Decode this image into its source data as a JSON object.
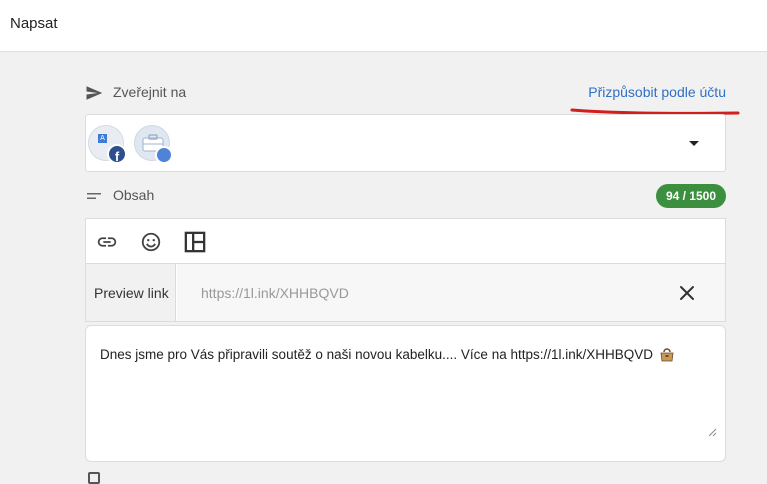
{
  "header": {
    "title": "Napsat"
  },
  "publish": {
    "label": "Zveřejnit na",
    "customize_link": "Přizpůsobit podle účtu"
  },
  "accounts": {
    "avatars": [
      {
        "type": "facebook",
        "icon": "facebook-icon",
        "badge": "f"
      },
      {
        "type": "google-my-business",
        "icon": "briefcase-icon"
      }
    ]
  },
  "content": {
    "label": "Obsah",
    "counter": "94 / 1500"
  },
  "toolbar": {
    "tools": [
      "link-icon",
      "emoji-icon",
      "layout-icon"
    ]
  },
  "preview": {
    "label": "Preview link",
    "placeholder": "https://1l.ink/XHHBQVD"
  },
  "post": {
    "text": "Dnes jsme pro Vás připravili soutěž o naši novou kabelku.... Více na https://1l.ink/XHHBQVD"
  },
  "colors": {
    "accent_link": "#2f6fc6",
    "counter_green": "#3b8f3e",
    "annotation_red": "#d11f1f",
    "facebook": "#2e4f8f"
  }
}
